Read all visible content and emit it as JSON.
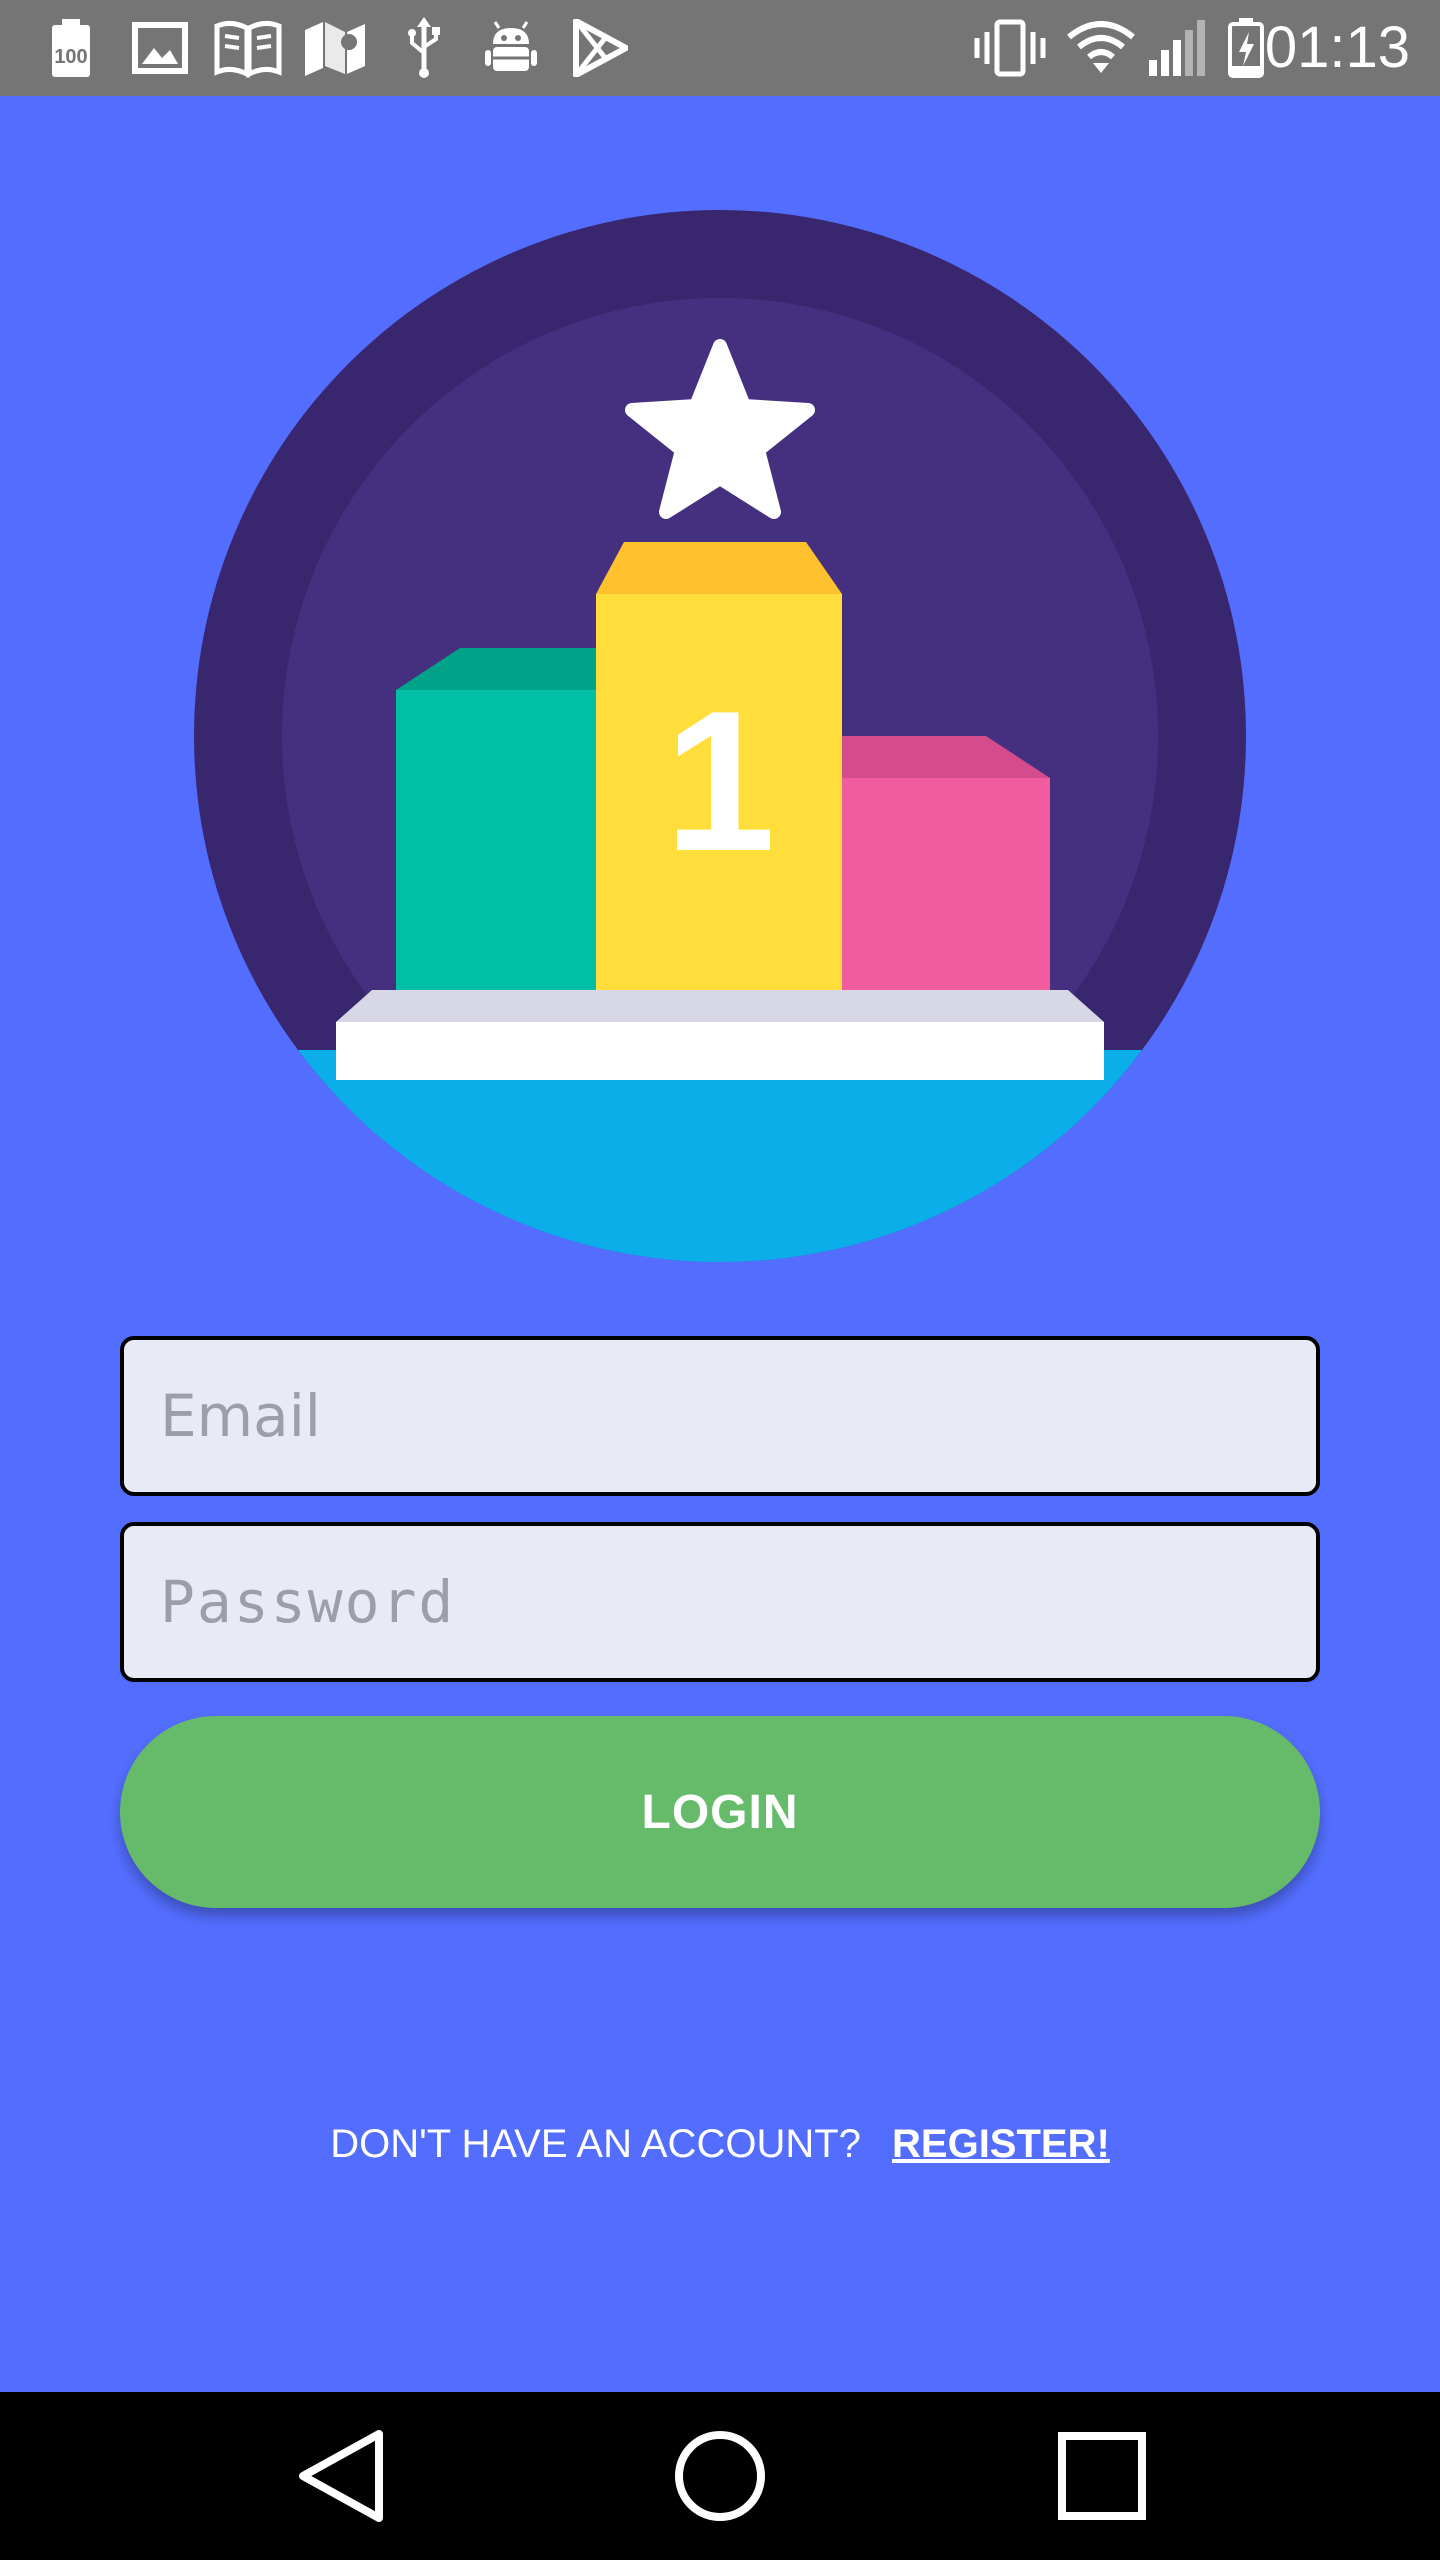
{
  "status_bar": {
    "time": "01:13",
    "left_icons": [
      "battery-100-icon",
      "image-icon",
      "book-icon",
      "maps-icon",
      "usb-icon",
      "android-debug-icon",
      "play-store-icon"
    ],
    "right_icons": [
      "vibrate-icon",
      "wifi-icon",
      "signal-icon",
      "battery-charging-icon"
    ]
  },
  "logo": {
    "podium_number": "1",
    "colors": {
      "outer_circle": "#38266E",
      "inner_circle": "#45307F",
      "left_block": "#00BFA5",
      "center_block": "#FFDD3A",
      "right_block": "#F15C9E",
      "base_top": "#FFFFFF",
      "base_bottom": "#0BAEE8",
      "star": "#FFFFFF"
    }
  },
  "form": {
    "email_placeholder": "Email",
    "email_value": "",
    "password_placeholder": "Password",
    "password_value": "",
    "login_label": "LOGIN"
  },
  "footer": {
    "prompt": "DON'T HAVE AN ACCOUNT?",
    "register_label": "REGISTER!"
  },
  "nav_bar": {
    "buttons": [
      "back-icon",
      "home-icon",
      "recents-icon"
    ]
  },
  "colors": {
    "background": "#536DFE",
    "status_bar": "#757575",
    "login_button": "#66BB6A",
    "field_background": "#E8EAF6",
    "nav_bar": "#000000"
  }
}
